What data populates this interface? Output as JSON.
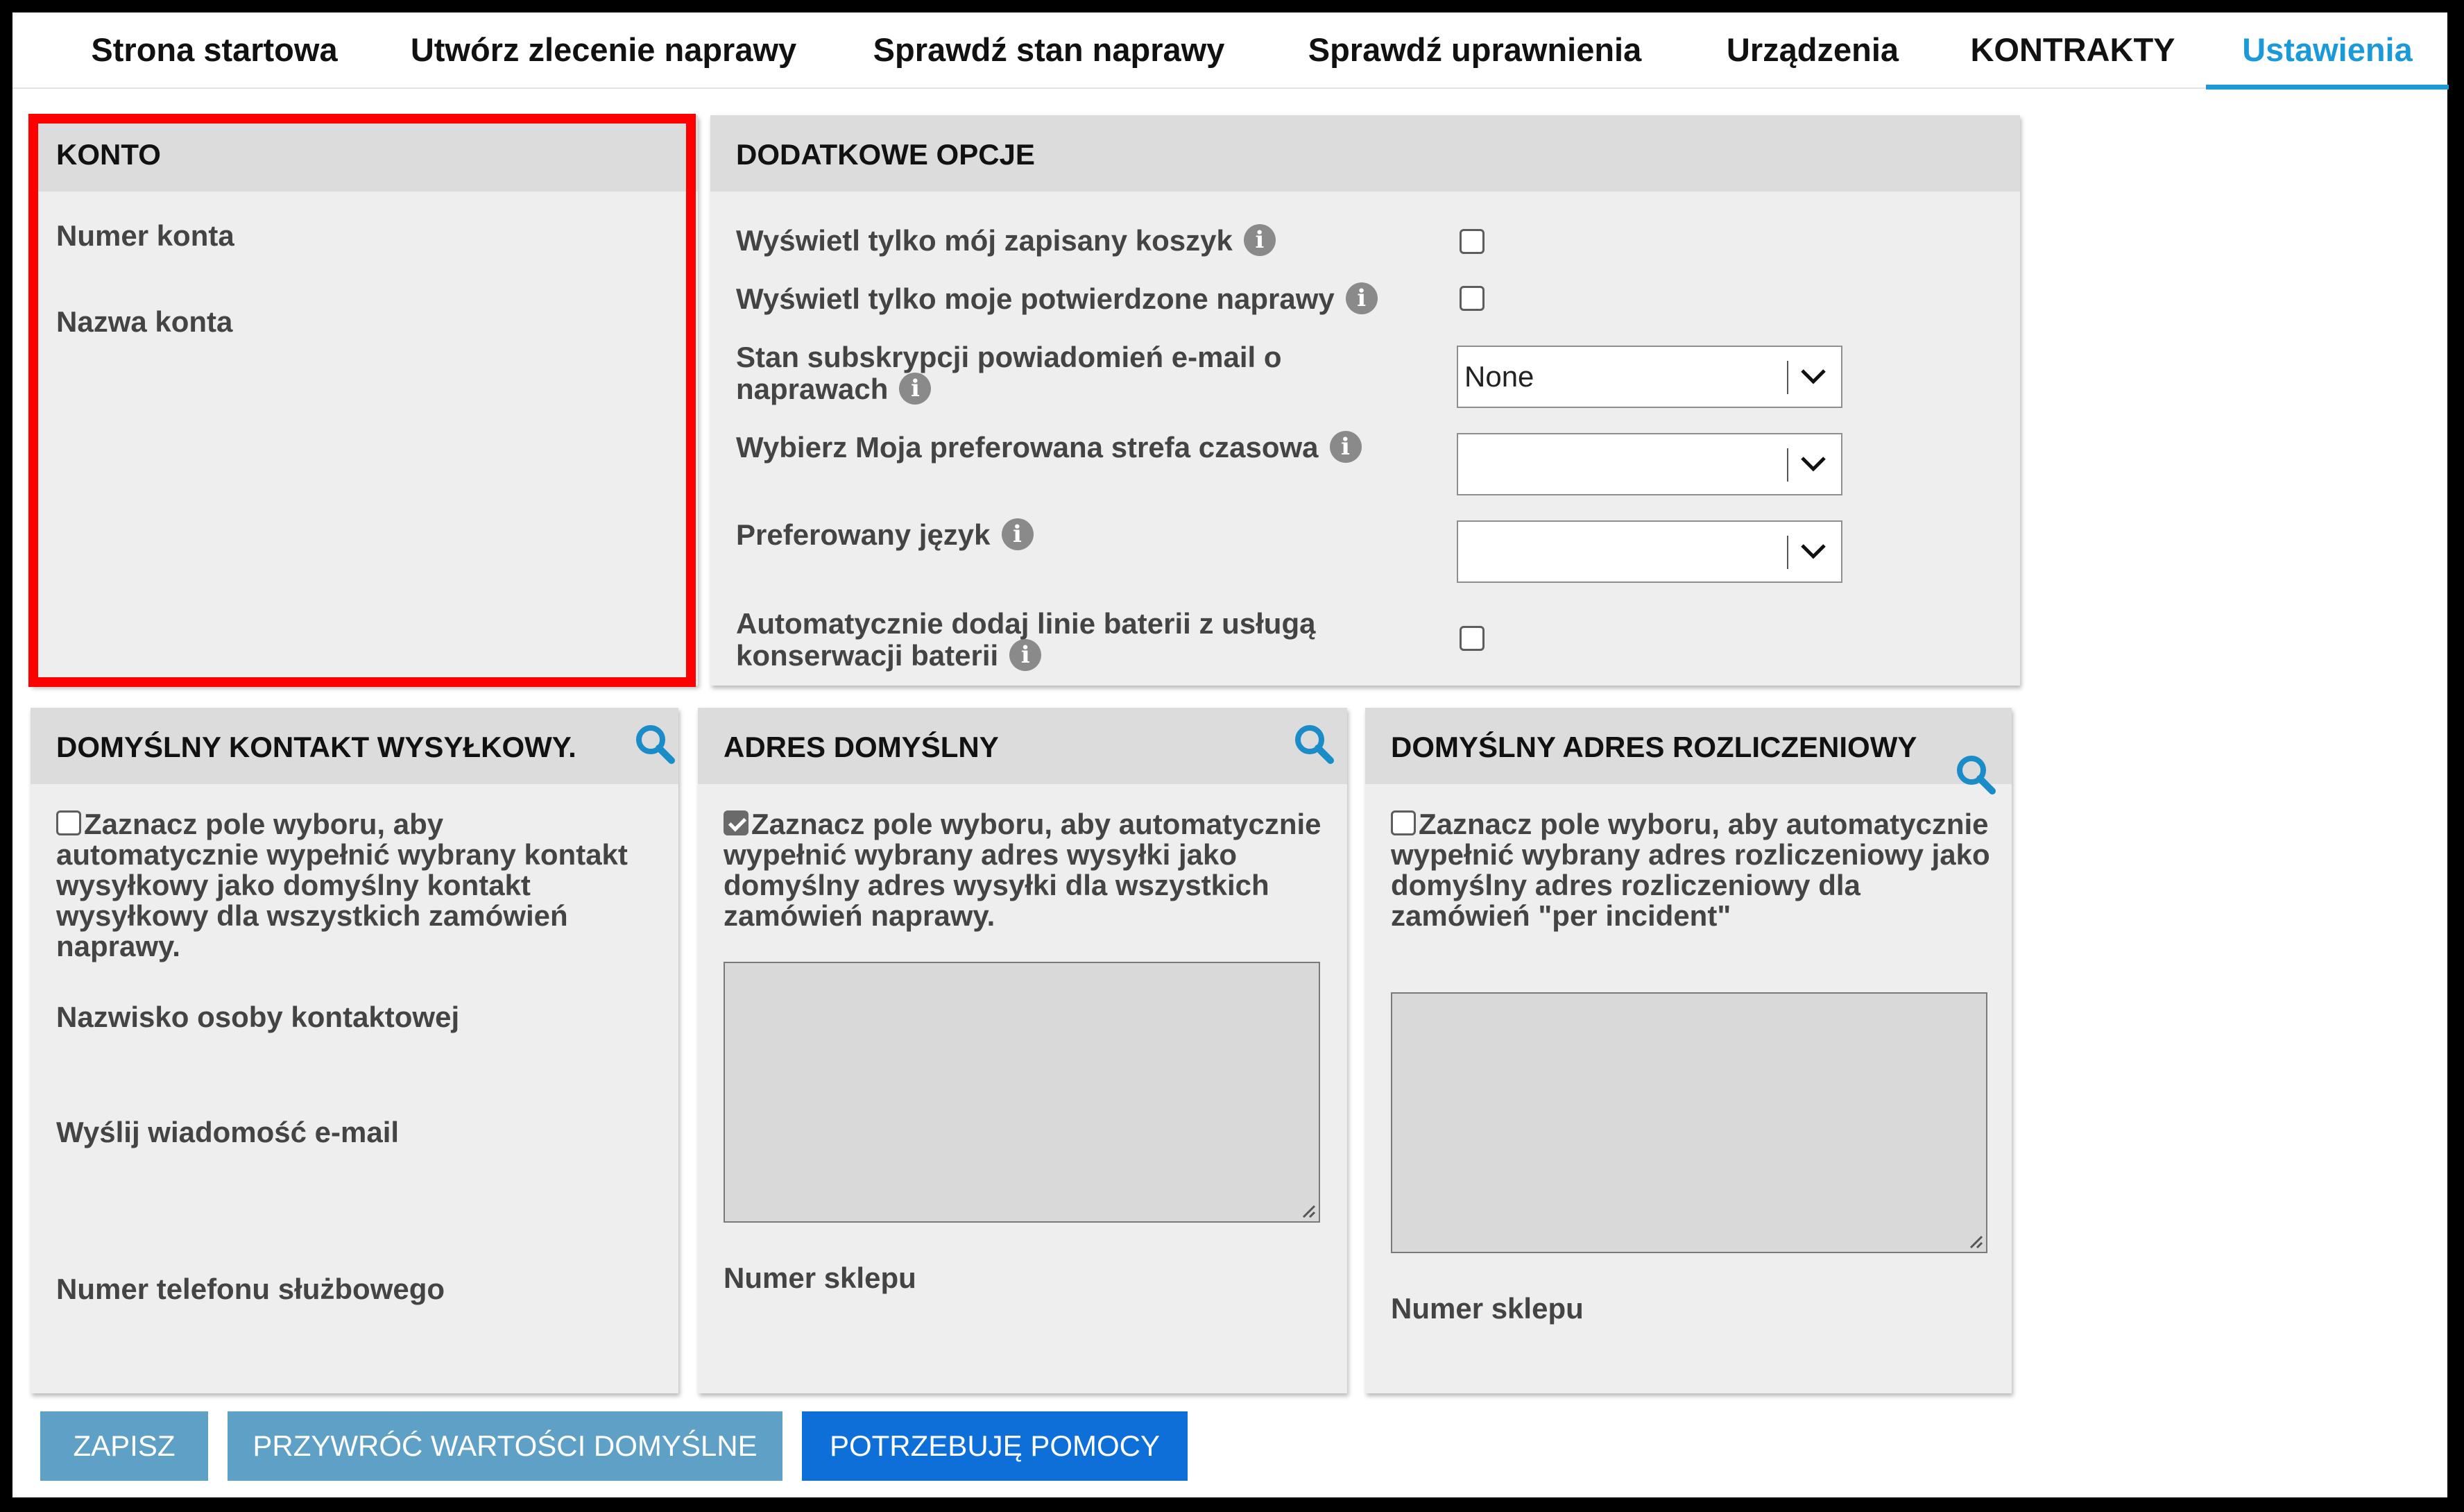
{
  "tabs": [
    {
      "label": "Strona startowa",
      "active": false
    },
    {
      "label": "Utwórz zlecenie naprawy",
      "active": false
    },
    {
      "label": "Sprawdź stan naprawy",
      "active": false
    },
    {
      "label": "Sprawdź uprawnienia",
      "active": false
    },
    {
      "label": "Urządzenia",
      "active": false
    },
    {
      "label": "KONTRAKTY",
      "active": false
    },
    {
      "label": "Ustawienia",
      "active": true
    }
  ],
  "konto": {
    "title": "KONTO",
    "account_number_label": "Numer konta",
    "account_name_label": "Nazwa konta"
  },
  "options": {
    "title": "DODATKOWE OPCJE",
    "show_saved_cart": {
      "label": "Wyświetl tylko mój zapisany koszyk",
      "checked": false
    },
    "show_confirmed_repairs": {
      "label": "Wyświetl tylko moje potwierdzone naprawy",
      "checked": false
    },
    "email_subscription": {
      "label": "Stan subskrypcji powiadomień e-mail o naprawach",
      "value": "None"
    },
    "timezone": {
      "label": "Wybierz Moja preferowana strefa czasowa",
      "value": ""
    },
    "language": {
      "label": "Preferowany język",
      "value": ""
    },
    "battery_service": {
      "label": "Automatycznie dodaj linie baterii z usługą konserwacji baterii",
      "checked": false
    },
    "info_icon_glyph": "i"
  },
  "shipping_contact": {
    "title": "DOMYŚLNY KONTAKT WYSYŁKOWY.",
    "checkbox_text": "Zaznacz pole wyboru, aby automatycznie wypełnić wybrany kontakt wysyłkowy jako domyślny kontakt wysyłkowy dla wszystkich zamówień naprawy.",
    "checked": false,
    "contact_name_label": "Nazwisko osoby kontaktowej",
    "email_label": "Wyślij wiadomość e-mail",
    "phone_label": "Numer telefonu służbowego"
  },
  "default_address": {
    "title": "ADRES DOMYŚLNY",
    "checkbox_text": "Zaznacz pole wyboru, aby automatycznie wypełnić wybrany adres wysyłki jako domyślny adres wysyłki dla wszystkich zamówień naprawy.",
    "checked": true,
    "address_text": "",
    "store_number_label": "Numer sklepu"
  },
  "billing_address": {
    "title": "DOMYŚLNY ADRES ROZLICZENIOWY",
    "checkbox_text": "Zaznacz pole wyboru, aby automatycznie wypełnić wybrany adres rozliczeniowy jako domyślny adres rozliczeniowy dla zamówień \"per incident\"",
    "checked": false,
    "address_text": "",
    "store_number_label": "Numer sklepu"
  },
  "buttons": {
    "save": "ZAPISZ",
    "restore_defaults": "PRZYWRÓĆ WARTOŚCI DOMYŚLNE",
    "need_help": "POTRZEBUJĘ POMOCY"
  },
  "colors": {
    "accent": "#1a9ad9",
    "highlight": "#ff0000",
    "primary_button": "#0f6fd9",
    "secondary_button": "#5fa0c6",
    "panel_bg": "#eeeeee",
    "panel_header_bg": "#dcdcdc"
  }
}
